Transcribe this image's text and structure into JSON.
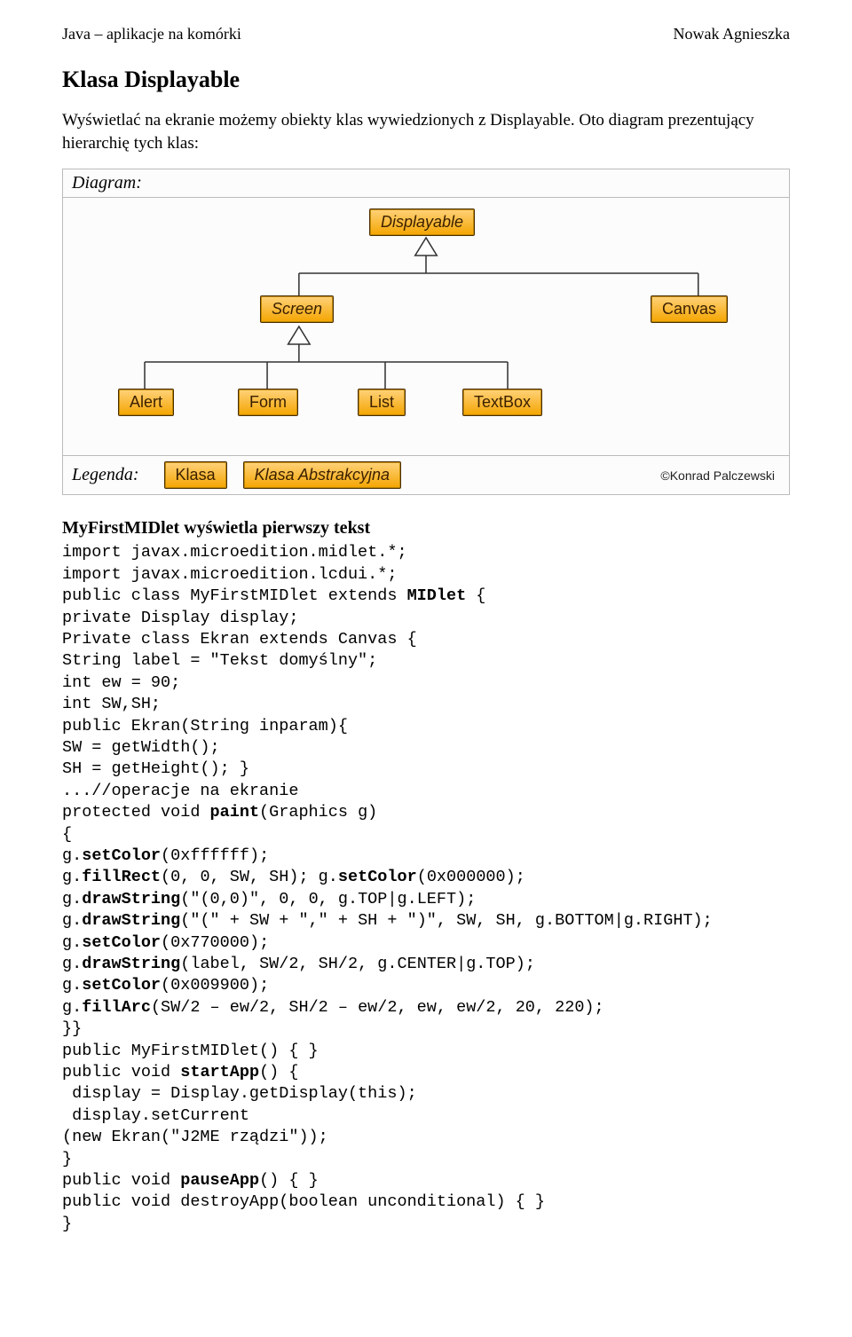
{
  "header": {
    "left": "Java – aplikacje na komórki",
    "right": "Nowak Agnieszka"
  },
  "title": "Klasa Displayable",
  "intro": "Wyświetlać na ekranie możemy obiekty klas wywiedzionych z Displayable. Oto diagram prezentujący hierarchię tych klas:",
  "diagram": {
    "label": "Diagram:",
    "nodes": {
      "displayable": "Displayable",
      "screen": "Screen",
      "canvas": "Canvas",
      "alert": "Alert",
      "form": "Form",
      "list": "List",
      "textbox": "TextBox"
    },
    "legend": {
      "title": "Legenda:",
      "klasa": "Klasa",
      "abstrakcyjna": "Klasa Abstrakcyjna"
    },
    "credit": "©Konrad Palczewski"
  },
  "section_title": "MyFirstMIDlet wyświetla pierwszy tekst",
  "code": {
    "l1": "import javax.microedition.midlet.*;",
    "l2": "import javax.microedition.lcdui.*;",
    "l3a": "public class MyFirstMIDlet extends ",
    "l3b": "MIDlet",
    "l3c": " {",
    "l4": "private Display display;",
    "l5": "Private class Ekran extends Canvas {",
    "l6": "String label = \"Tekst domyślny\";",
    "l7": "int ew = 90;",
    "l8": "int SW,SH;",
    "l9": "public Ekran(String inparam){",
    "l10": "SW = getWidth();",
    "l11": "SH = getHeight(); }",
    "l12": "...//operacje na ekranie",
    "l13a": "protected void ",
    "l13b": "paint",
    "l13c": "(Graphics g)",
    "l14": "{",
    "l15a": "g.",
    "l15b": "setColor",
    "l15c": "(0xffffff);",
    "l16a": "g.",
    "l16b": "fillRect",
    "l16c": "(0, 0, SW, SH); g.",
    "l16d": "setColor",
    "l16e": "(0x000000);",
    "l17a": "g.",
    "l17b": "drawString",
    "l17c": "(\"(0,0)\", 0, 0, g.TOP|g.LEFT);",
    "l18a": "g.",
    "l18b": "drawString",
    "l18c": "(\"(\" + SW + \",\" + SH + \")\", SW, SH, g.BOTTOM|g.RIGHT);",
    "l19a": "g.",
    "l19b": "setColor",
    "l19c": "(0x770000);",
    "l20a": "g.",
    "l20b": "drawString",
    "l20c": "(label, SW/2, SH/2, g.CENTER|g.TOP);",
    "l21a": "g.",
    "l21b": "setColor",
    "l21c": "(0x009900);",
    "l22a": "g.",
    "l22b": "fillArc",
    "l22c": "(SW/2 – ew/2, SH/2 – ew/2, ew, ew/2, 20, 220);",
    "l23": "}}",
    "l24": "public MyFirstMIDlet() { }",
    "l25a": "public void ",
    "l25b": "startApp",
    "l25c": "() {",
    "l26": " display = Display.getDisplay(this);",
    "l27": " display.setCurrent",
    "l28": "(new Ekran(\"J2ME rządzi\"));",
    "l29": "}",
    "l30a": "public void ",
    "l30b": "pauseApp",
    "l30c": "() { }",
    "l31": "public void destroyApp(boolean unconditional) { }",
    "l32": "}"
  }
}
